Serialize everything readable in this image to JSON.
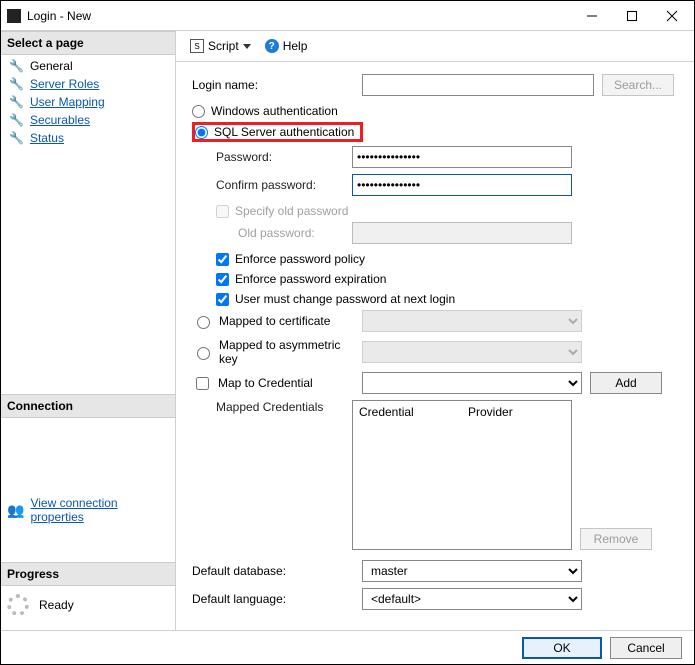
{
  "window": {
    "title": "Login - New"
  },
  "sidebar": {
    "select_page_header": "Select a page",
    "pages": [
      {
        "label": "General"
      },
      {
        "label": "Server Roles"
      },
      {
        "label": "User Mapping"
      },
      {
        "label": "Securables"
      },
      {
        "label": "Status"
      }
    ],
    "connection_header": "Connection",
    "view_connection_properties": "View connection properties",
    "progress_header": "Progress",
    "progress_status": "Ready"
  },
  "toolbar": {
    "script": "Script",
    "help": "Help"
  },
  "form": {
    "login_name_label": "Login name:",
    "login_name_value": "",
    "search_button": "Search...",
    "auth": {
      "windows": "Windows authentication",
      "sql": "SQL Server authentication",
      "selected": "sql"
    },
    "password_label": "Password:",
    "password_value": "•••••••••••••••",
    "confirm_label": "Confirm password:",
    "confirm_value": "•••••••••••••••",
    "specify_old_label": "Specify old password",
    "specify_old_checked": false,
    "old_password_label": "Old password:",
    "old_password_value": "",
    "enforce_policy_label": "Enforce password policy",
    "enforce_policy_checked": true,
    "enforce_expiration_label": "Enforce password expiration",
    "enforce_expiration_checked": true,
    "must_change_label": "User must change password at next login",
    "must_change_checked": true,
    "mapped_cert_label": "Mapped to certificate",
    "mapped_asym_label": "Mapped to asymmetric key",
    "map_credential_label": "Map to Credential",
    "map_credential_checked": false,
    "add_button": "Add",
    "mapped_credentials_label": "Mapped Credentials",
    "table_headers": {
      "credential": "Credential",
      "provider": "Provider"
    },
    "remove_button": "Remove",
    "default_database_label": "Default database:",
    "default_database_value": "master",
    "default_language_label": "Default language:",
    "default_language_value": "<default>"
  },
  "footer": {
    "ok": "OK",
    "cancel": "Cancel"
  }
}
